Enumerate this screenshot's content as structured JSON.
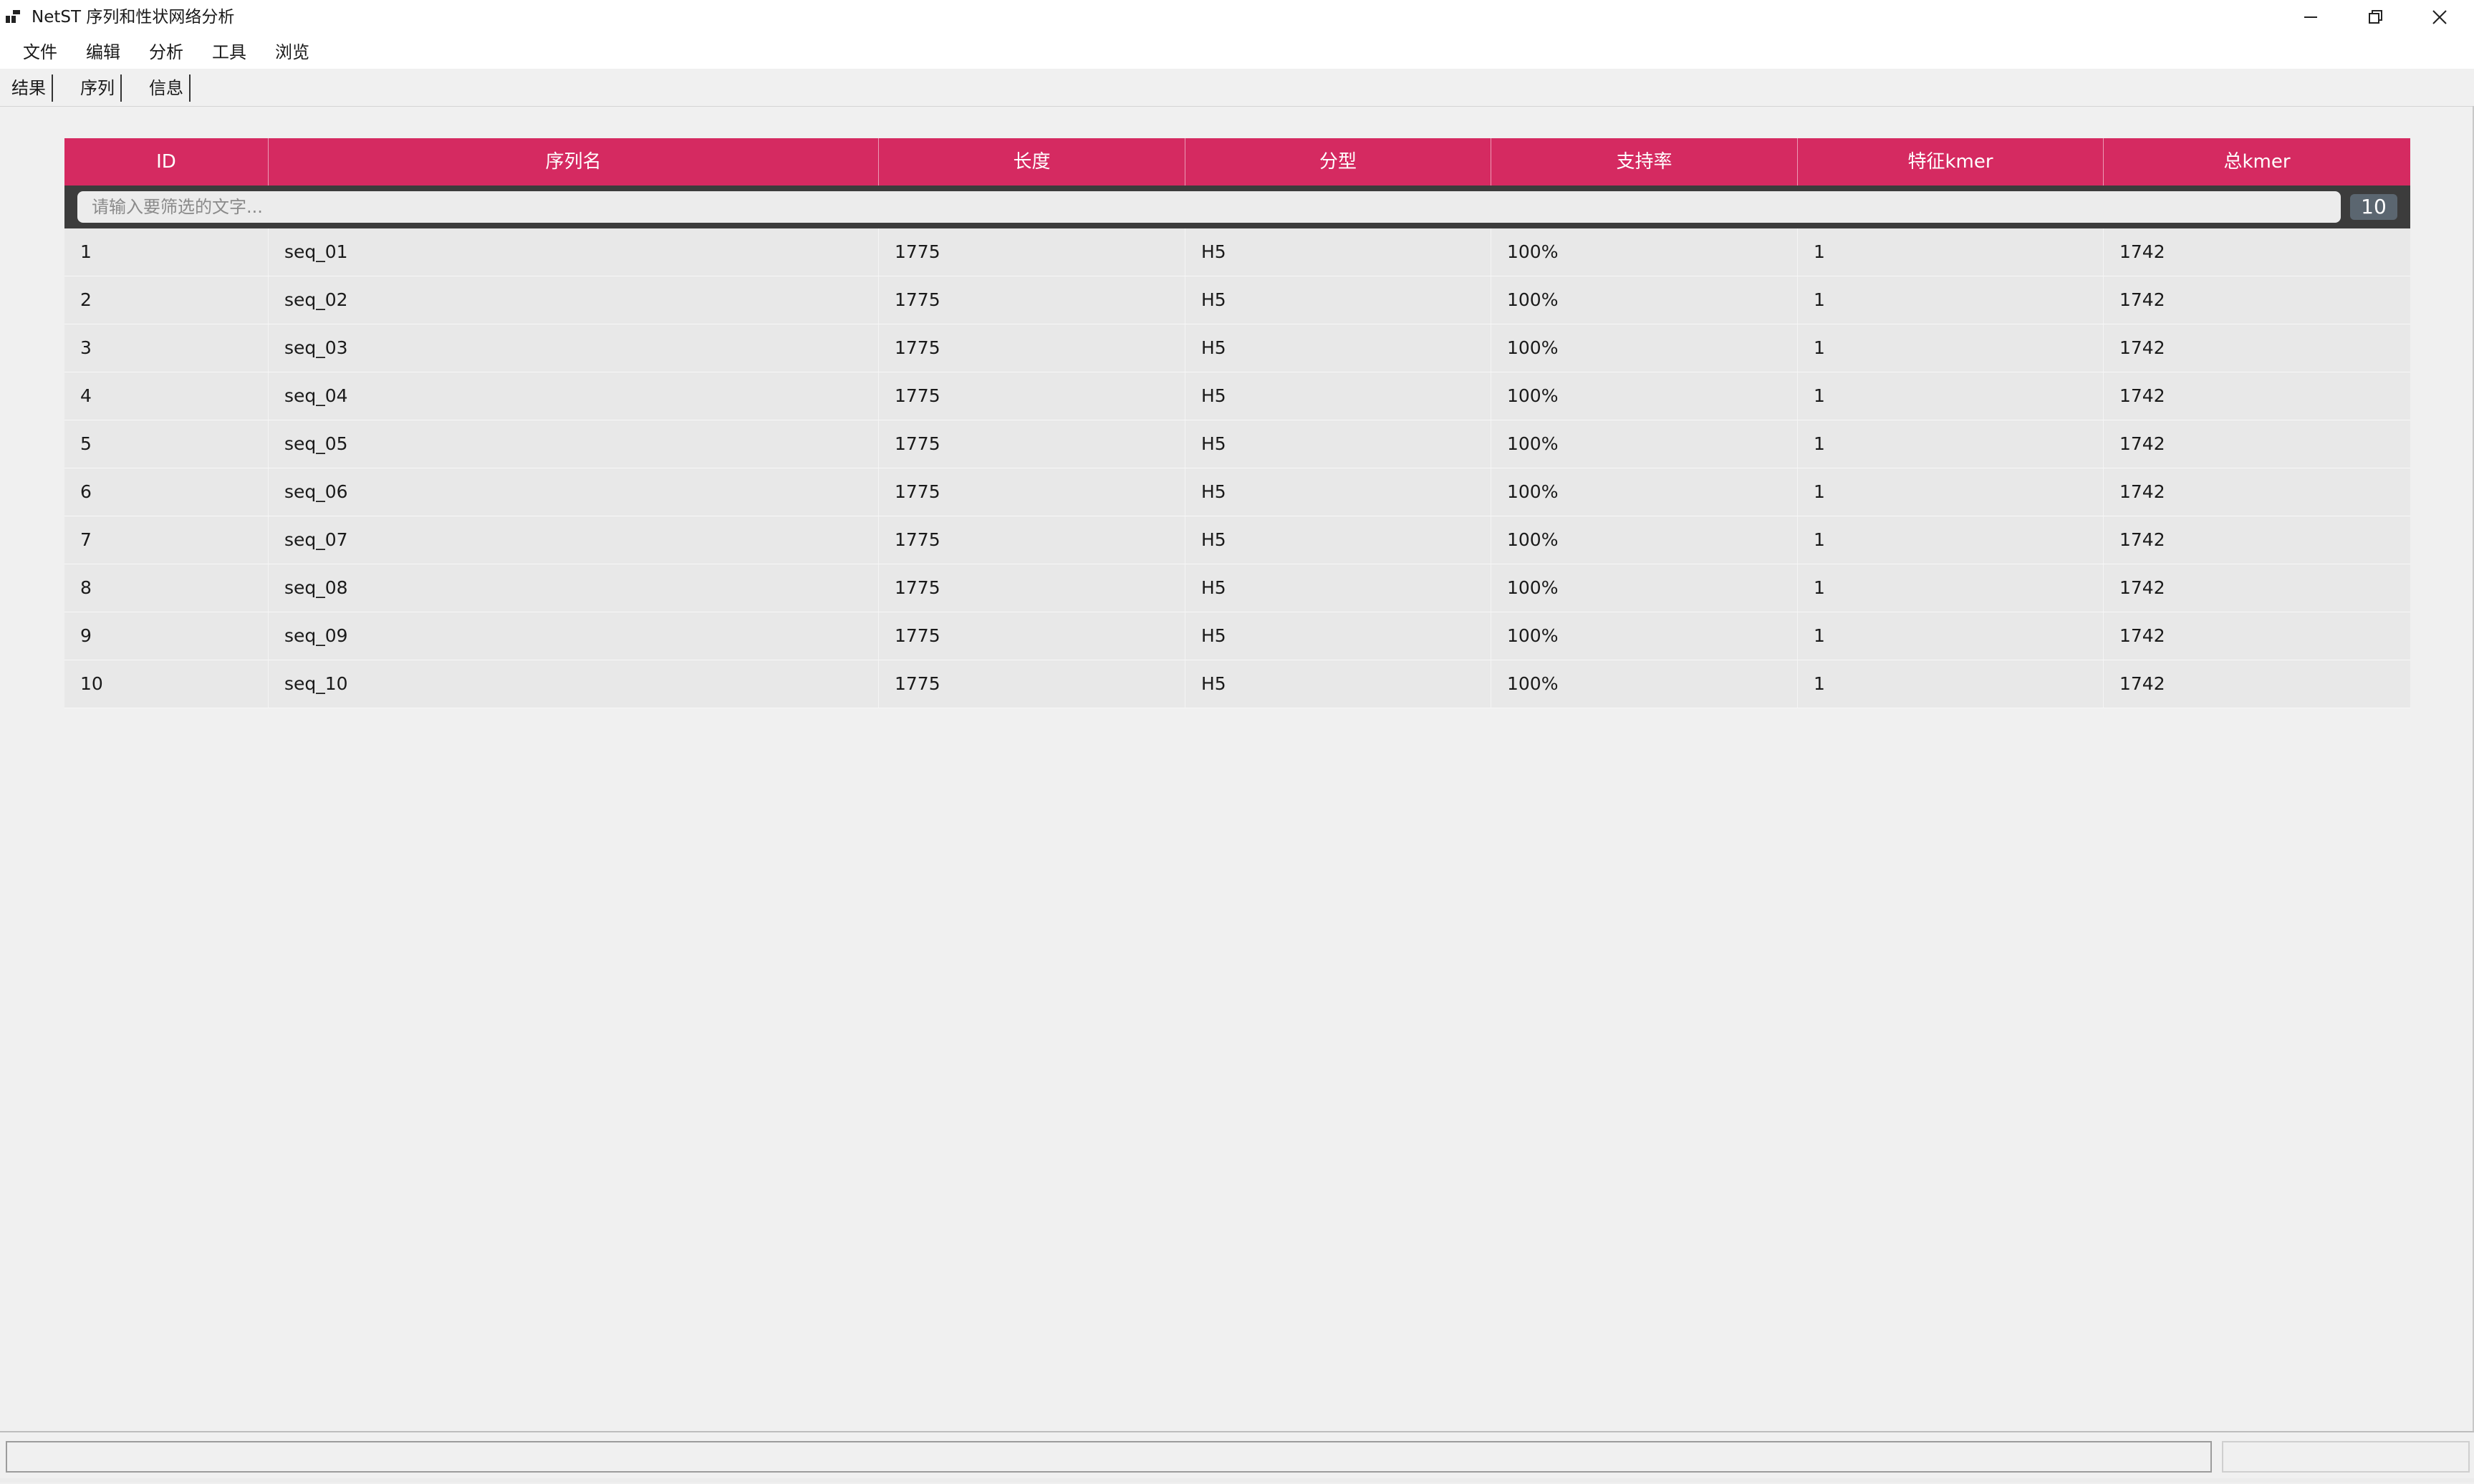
{
  "window": {
    "title": "NetST 序列和性状网络分析"
  },
  "menu": [
    "文件",
    "编辑",
    "分析",
    "工具",
    "浏览"
  ],
  "tabs": [
    "结果",
    "序列",
    "信息"
  ],
  "table": {
    "headers": [
      "ID",
      "序列名",
      "长度",
      "分型",
      "支持率",
      "特征kmer",
      "总kmer"
    ],
    "filter_placeholder": "请输入要筛选的文字...",
    "count": "10",
    "rows": [
      [
        "1",
        "seq_01",
        "1775",
        "H5",
        "100%",
        "1",
        "1742"
      ],
      [
        "2",
        "seq_02",
        "1775",
        "H5",
        "100%",
        "1",
        "1742"
      ],
      [
        "3",
        "seq_03",
        "1775",
        "H5",
        "100%",
        "1",
        "1742"
      ],
      [
        "4",
        "seq_04",
        "1775",
        "H5",
        "100%",
        "1",
        "1742"
      ],
      [
        "5",
        "seq_05",
        "1775",
        "H5",
        "100%",
        "1",
        "1742"
      ],
      [
        "6",
        "seq_06",
        "1775",
        "H5",
        "100%",
        "1",
        "1742"
      ],
      [
        "7",
        "seq_07",
        "1775",
        "H5",
        "100%",
        "1",
        "1742"
      ],
      [
        "8",
        "seq_08",
        "1775",
        "H5",
        "100%",
        "1",
        "1742"
      ],
      [
        "9",
        "seq_09",
        "1775",
        "H5",
        "100%",
        "1",
        "1742"
      ],
      [
        "10",
        "seq_10",
        "1775",
        "H5",
        "100%",
        "1",
        "1742"
      ]
    ]
  },
  "icons": {
    "app": "app-grid-icon",
    "minimize": "minimize-icon",
    "restore": "restore-icon",
    "close": "close-icon"
  },
  "colors": {
    "header_accent": "#d52a61",
    "filter_bar": "#3c3c3c",
    "count_badge": "#5b6670"
  }
}
